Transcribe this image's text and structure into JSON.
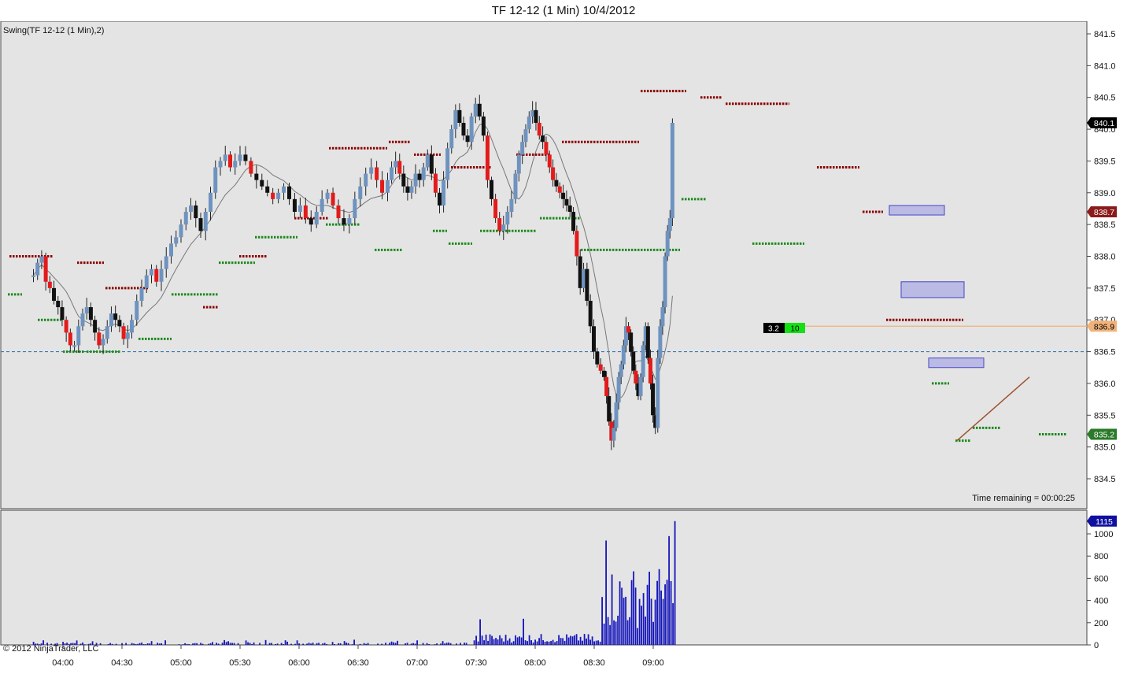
{
  "window": {
    "title": "TF 12-12 (1 Min)  10/4/2012"
  },
  "panel_label": "Swing(TF 12-12 (1 Min),2)",
  "time_remaining": "Time remaining = 00:00:25",
  "copyright": "© 2012 NinjaTrader, LLC",
  "position_box": {
    "value1": "3.2",
    "value2": "10"
  },
  "colors": {
    "up_bar": "#6f93bf",
    "down_bar_red": "#e21b1b",
    "down_bar_black": "#111111",
    "swing_high": "#8b0000",
    "swing_low": "#1d8a1d",
    "volume": "#1616bb",
    "panel_bg": "#e4e4e4",
    "last_price_label": "#000000",
    "high_label": "#8b1a1a",
    "low_label": "#2a7a2a",
    "position_line": "#f0b27a"
  },
  "chart_data": [
    {
      "type": "candlestick",
      "title": "TF 12-12 (1 Min)  10/4/2012",
      "ylim": [
        834.2,
        841.7
      ],
      "y_ticks": [
        "841.5",
        "841.0",
        "840.5",
        "840.0",
        "839.5",
        "839.0",
        "838.5",
        "838.0",
        "837.5",
        "837.0",
        "836.5",
        "836.0",
        "835.5",
        "835.0",
        "834.5"
      ],
      "x_ticks": [
        "04:00",
        "04:30",
        "05:00",
        "05:30",
        "06:00",
        "06:30",
        "07:00",
        "07:30",
        "08:00",
        "08:30",
        "09:00"
      ],
      "price_labels": {
        "last": "840.1",
        "swing_high": "838.7",
        "position": "836.9",
        "swing_low": "835.2"
      },
      "dashed_level": 836.5,
      "position_level": 836.9,
      "series": [
        {
          "session": "03:45-04:35",
          "close_path": [
            837.7,
            837.9,
            838.0,
            837.6,
            837.5,
            837.3,
            837.2,
            837.0,
            836.8,
            836.6,
            836.6,
            836.9,
            837.1,
            837.2,
            837.0,
            836.8,
            836.6,
            836.7,
            836.9,
            837.1,
            837.0,
            836.9,
            836.7,
            836.8
          ]
        },
        {
          "session": "04:35-05:30",
          "close_path": [
            837.0,
            837.3,
            837.5,
            837.7,
            837.8,
            837.6,
            837.8,
            838.0,
            838.2,
            838.3,
            838.5,
            838.7,
            838.8,
            838.6,
            838.4,
            838.7,
            839.0,
            839.4,
            839.5,
            839.6,
            839.4,
            839.5
          ]
        },
        {
          "session": "05:30-06:45",
          "close_path": [
            839.6,
            839.5,
            839.3,
            839.2,
            839.1,
            839.0,
            838.9,
            839.0,
            839.1,
            838.9,
            838.7,
            838.8,
            838.6,
            838.5,
            838.7,
            838.9,
            839.0,
            838.8,
            838.6,
            838.5,
            838.6,
            838.9,
            839.1,
            839.3,
            839.4,
            839.2,
            839.0
          ]
        },
        {
          "session": "06:45-07:50",
          "close_path": [
            839.2,
            839.4,
            839.5,
            839.3,
            839.1,
            839.0,
            839.1,
            839.3,
            839.2,
            839.4,
            839.6,
            839.3,
            839.0,
            838.8,
            839.2,
            839.7,
            840.0,
            840.3,
            840.1,
            839.9,
            839.8,
            840.2,
            840.4,
            840.2,
            839.9,
            839.2,
            838.9,
            838.6,
            838.4,
            838.5,
            838.7,
            838.9
          ]
        },
        {
          "session": "07:50-08:35",
          "close_path": [
            839.3,
            839.6,
            839.8,
            840.0,
            840.2,
            840.3,
            840.1,
            839.9,
            839.8,
            839.6,
            839.4,
            839.2,
            839.1,
            839.0,
            838.9,
            838.8,
            838.7,
            838.4,
            838.0,
            837.5,
            837.8,
            837.3,
            836.9,
            836.5,
            836.3,
            836.2
          ]
        },
        {
          "session": "08:35-09:05",
          "close_path": [
            836.1,
            835.8,
            835.4,
            835.1,
            835.3,
            835.7,
            836.1,
            836.3,
            836.6,
            836.9,
            836.8,
            836.5,
            836.2,
            836.0,
            835.8,
            836.1,
            836.6,
            836.9,
            836.4,
            836.0,
            835.5,
            835.3,
            836.4,
            836.9,
            837.2,
            838.0,
            838.4,
            838.6,
            840.1
          ]
        }
      ],
      "swing_highs": [
        838.0,
        837.9,
        837.5,
        837.2,
        838.0,
        838.6,
        839.7,
        839.8,
        839.6,
        839.4,
        839.6,
        839.8,
        840.6,
        840.5,
        840.4,
        839.4,
        838.7,
        837.0,
        837.0
      ],
      "swing_lows": [
        837.4,
        837.0,
        836.5,
        836.5,
        836.7,
        837.4,
        837.9,
        838.3,
        838.5,
        838.1,
        838.4,
        838.2,
        838.4,
        838.6,
        838.1,
        838.9,
        838.2,
        836.0,
        835.1,
        835.3,
        835.2
      ]
    },
    {
      "type": "bar",
      "title": "",
      "ylim": [
        0,
        1115
      ],
      "y_ticks": [
        "1000",
        "800",
        "600",
        "400",
        "200",
        "0"
      ],
      "last_label": "1115",
      "volume_profile": [
        {
          "time": "03:45-07:30",
          "typical": 30,
          "max": 90
        },
        {
          "time": "07:30",
          "value": 260
        },
        {
          "time": "07:52",
          "value": 310
        },
        {
          "time": "08:30",
          "value": 940
        },
        {
          "time": "08:35",
          "value": 660
        },
        {
          "time": "08:45",
          "value": 610
        },
        {
          "time": "09:00",
          "value": 980
        },
        {
          "time": "09:10",
          "value": 1115
        }
      ]
    }
  ]
}
